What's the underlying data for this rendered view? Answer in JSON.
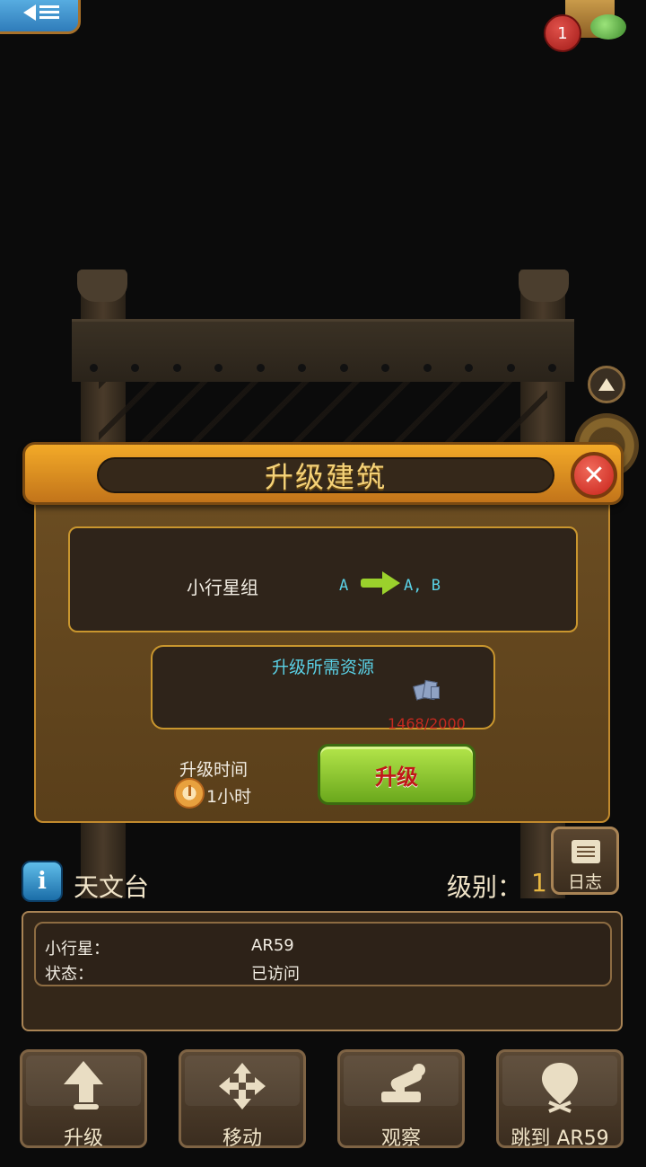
{
  "top": {
    "notification_count": "1"
  },
  "dialog": {
    "title": "升级建筑",
    "close_symbol": "✕",
    "building_label": "小行星组",
    "level_from": "A",
    "level_to": "A, B",
    "resources_title": "升级所需资源",
    "resource_icon": "ore-icon",
    "resource_count": "1468/2000",
    "time_label": "升级时间",
    "time_value": "1小时",
    "upgrade_button": "升级"
  },
  "info": {
    "icon_letter": "i",
    "building_name": "天文台",
    "level_label": "级别：",
    "level_value": "1",
    "log_label": "日志",
    "rows": [
      {
        "label": "小行星：",
        "value": "AR59"
      },
      {
        "label": "状态：",
        "value": "已访问"
      }
    ]
  },
  "toolbar": [
    {
      "label": "升级",
      "icon": "upgrade-arrow-icon"
    },
    {
      "label": "移动",
      "icon": "move-arrows-icon"
    },
    {
      "label": "观察",
      "icon": "telescope-icon"
    },
    {
      "label": "跳到 AR59",
      "icon": "pin-icon"
    }
  ],
  "colors": {
    "accent_gold": "#f3aa28",
    "cyan_text": "#5ad1e6",
    "insufficient_red": "#c4291f",
    "button_green": "#9bd12c"
  }
}
